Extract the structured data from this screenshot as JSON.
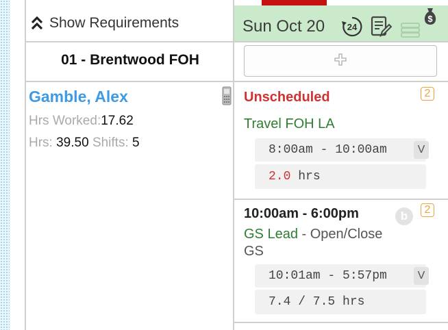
{
  "toolbar": {
    "show_requirements_label": "Show Requirements",
    "show_requirements_icon": "double-chevron-up-icon"
  },
  "day": {
    "title": "Sun Oct 20",
    "cycle_badge": "24",
    "header_color": "#cbeacb",
    "top_bar_color": "#c51010"
  },
  "location": {
    "name": "01 - Brentwood FOH"
  },
  "add_shift": {
    "icon": "plus-icon"
  },
  "employee": {
    "name": "Gamble, Alex",
    "hrs_worked_label": "Hrs Worked:",
    "hrs_worked_value": "17.62",
    "hrs_label": "Hrs:",
    "hrs_value": "39.50",
    "shifts_label": "Shifts:",
    "shifts_value": "5",
    "device_icon": "phone-icon",
    "name_color": "#3d9be6"
  },
  "shifts": [
    {
      "status": "Unscheduled",
      "badge": "2",
      "position": "Travel FOH LA",
      "punch_time": "8:00am - 10:00am",
      "punch_tag": "V",
      "hours_value": "2.0",
      "hours_unit": "hrs"
    },
    {
      "time": "10:00am - 6:00pm",
      "break_tag": "b",
      "badge": "2",
      "position": "GS Lead",
      "location_suffix": " - Open/Close",
      "location_cont": "GS",
      "punch_time": "10:01am - 5:57pm",
      "punch_tag": "V",
      "hours": "7.4 / 7.5 hrs"
    }
  ],
  "colors": {
    "unscheduled": "#d23131",
    "position_green": "#2f7d32",
    "badge_orange": "#f0a13a"
  }
}
